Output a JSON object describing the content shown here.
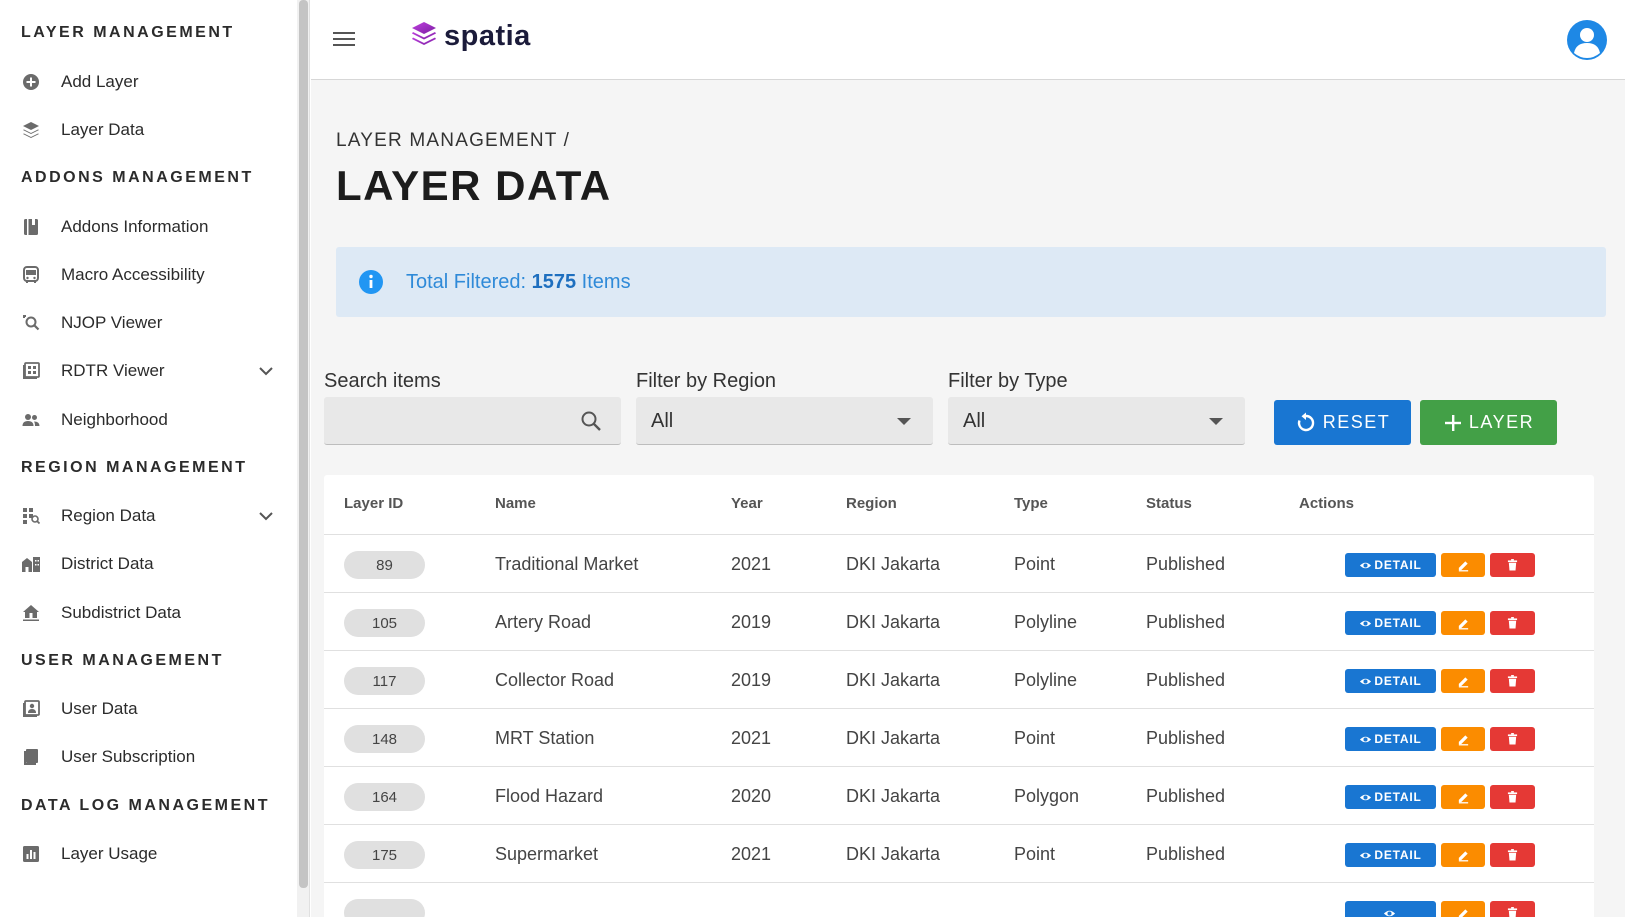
{
  "app": {
    "logo_text": "spatia"
  },
  "sidebar": {
    "sections": [
      {
        "title": "LAYER MANAGEMENT",
        "items": [
          {
            "label": "Add Layer",
            "icon": "plus-circle-icon"
          },
          {
            "label": "Layer Data",
            "icon": "layers-icon"
          }
        ]
      },
      {
        "title": "ADDONS MANAGEMENT",
        "items": [
          {
            "label": "Addons Information",
            "icon": "book-icon"
          },
          {
            "label": "Macro Accessibility",
            "icon": "bus-icon"
          },
          {
            "label": "NJOP Viewer",
            "icon": "search-location-icon"
          },
          {
            "label": "RDTR Viewer",
            "icon": "grid-doc-icon",
            "expandable": true
          },
          {
            "label": "Neighborhood",
            "icon": "people-icon"
          }
        ]
      },
      {
        "title": "REGION MANAGEMENT",
        "items": [
          {
            "label": "Region Data",
            "icon": "map-grid-icon",
            "expandable": true
          },
          {
            "label": "District Data",
            "icon": "buildings-icon"
          },
          {
            "label": "Subdistrict Data",
            "icon": "house-icon"
          }
        ]
      },
      {
        "title": "USER MANAGEMENT",
        "items": [
          {
            "label": "User Data",
            "icon": "user-card-icon"
          },
          {
            "label": "User Subscription",
            "icon": "bookmark-icon"
          }
        ]
      },
      {
        "title": "DATA LOG MANAGEMENT",
        "items": [
          {
            "label": "Layer Usage",
            "icon": "bar-chart-icon"
          }
        ]
      }
    ]
  },
  "page": {
    "breadcrumb": "LAYER MANAGEMENT /",
    "title": "LAYER DATA",
    "info_prefix": "Total Filtered: ",
    "info_count": "1575",
    "info_suffix": " Items"
  },
  "filters": {
    "search_label": "Search items",
    "search_value": "",
    "region_label": "Filter by Region",
    "region_value": "All",
    "type_label": "Filter by Type",
    "type_value": "All"
  },
  "buttons": {
    "reset": "RESET",
    "add_layer": "LAYER"
  },
  "table": {
    "headers": [
      "Layer ID",
      "Name",
      "Year",
      "Region",
      "Type",
      "Status",
      "Actions"
    ],
    "detail_label": "DETAIL",
    "rows": [
      {
        "id": "89",
        "name": "Traditional Market",
        "year": "2021",
        "region": "DKI Jakarta",
        "type": "Point",
        "status": "Published"
      },
      {
        "id": "105",
        "name": "Artery Road",
        "year": "2019",
        "region": "DKI Jakarta",
        "type": "Polyline",
        "status": "Published"
      },
      {
        "id": "117",
        "name": "Collector Road",
        "year": "2019",
        "region": "DKI Jakarta",
        "type": "Polyline",
        "status": "Published"
      },
      {
        "id": "148",
        "name": "MRT Station",
        "year": "2021",
        "region": "DKI Jakarta",
        "type": "Point",
        "status": "Published"
      },
      {
        "id": "164",
        "name": "Flood Hazard",
        "year": "2020",
        "region": "DKI Jakarta",
        "type": "Polygon",
        "status": "Published"
      },
      {
        "id": "175",
        "name": "Supermarket",
        "year": "2021",
        "region": "DKI Jakarta",
        "type": "Point",
        "status": "Published"
      }
    ]
  },
  "colors": {
    "primary": "#1976d2",
    "success": "#43a047",
    "warning": "#fb8c00",
    "danger": "#e53935",
    "brand": "#8e24aa"
  }
}
